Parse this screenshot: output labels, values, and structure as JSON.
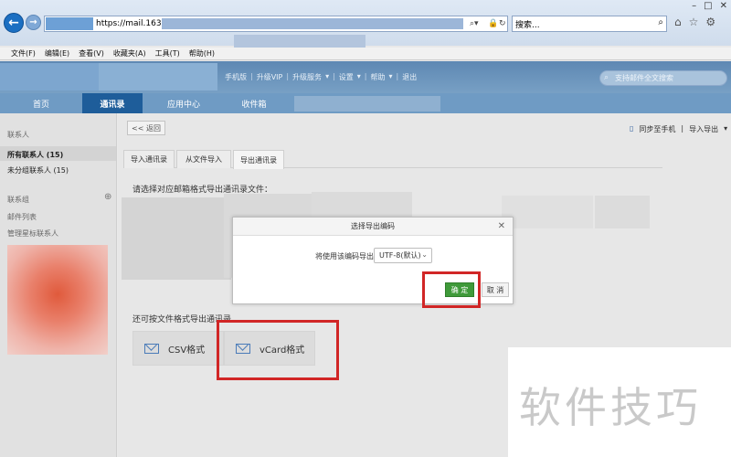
{
  "browser": {
    "url_text": "https://mail.163.com",
    "search_placeholder": "搜索...",
    "menu": [
      "文件(F)",
      "编辑(E)",
      "查看(V)",
      "收藏夹(A)",
      "工具(T)",
      "帮助(H)"
    ]
  },
  "header": {
    "top_links": [
      "手机版",
      "升级VIP",
      "升级服务",
      "设置",
      "帮助",
      "退出"
    ],
    "search_placeholder": "支持邮件全文搜索"
  },
  "tabs": [
    "首页",
    "通讯录",
    "应用中心",
    "收件箱"
  ],
  "sidebar": {
    "section_contacts": "联系人",
    "all_contacts": "所有联系人 (15)",
    "ungrouped": "未分组联系人 (15)",
    "section_groups": "联系组",
    "mail_list": "邮件列表",
    "manage_star": "管理星标联系人"
  },
  "main": {
    "back_label": "<< 返回",
    "sync_label": "同步至手机",
    "import_export_label": "导入导出",
    "subtabs": [
      "导入通讯录",
      "从文件导入",
      "导出通讯录"
    ],
    "prompt": "请选择对应邮箱格式导出通讯录文件：",
    "also_text": "还可按文件格式导出通讯录",
    "csv_label": "CSV格式",
    "vcard_label": "vCard格式"
  },
  "dialog": {
    "title": "选择导出编码",
    "label": "将使用该编码导出：",
    "selected_encoding": "UTF-8(默认)",
    "ok_label": "确 定",
    "cancel_label": "取 消"
  },
  "watermark": "软件技巧",
  "colors": {
    "highlight_red": "#d12626",
    "ok_green": "#3f9a3a",
    "active_tab": "#1e5d9a"
  }
}
